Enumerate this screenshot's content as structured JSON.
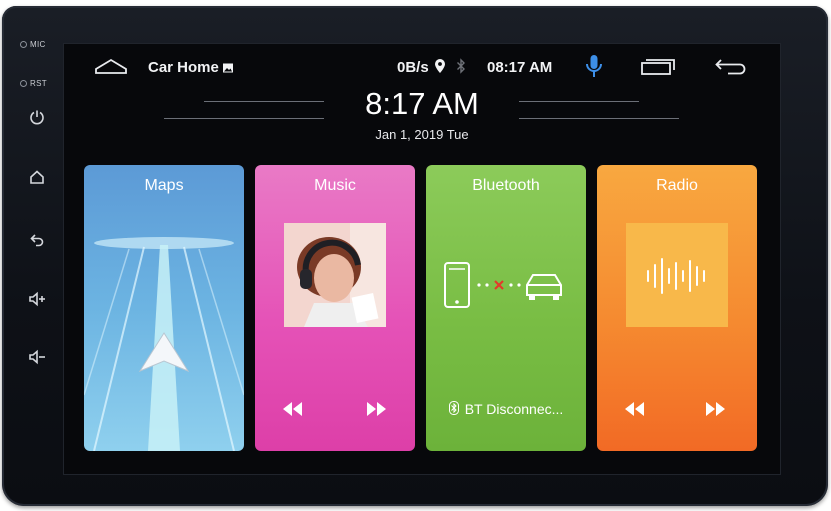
{
  "side_panel": {
    "mic_label": "MIC",
    "rst_label": "RST",
    "buttons": [
      "power-icon",
      "home-icon",
      "back-icon",
      "volume-up-icon",
      "volume-down-icon"
    ]
  },
  "status_bar": {
    "app_title": "Car Home",
    "net_speed": "0B/s",
    "time": "08:17 AM",
    "icons": [
      "home-outline-icon",
      "image-icon",
      "location-pin-icon",
      "bluetooth-icon",
      "microphone-icon",
      "recent-apps-icon",
      "back-arrow-icon"
    ]
  },
  "clock": {
    "time": "8:17 AM",
    "date": "Jan 1, 2019  Tue"
  },
  "cards": {
    "maps": {
      "title": "Maps",
      "color": "#5c9ad6"
    },
    "music": {
      "title": "Music",
      "color": "#e552b7"
    },
    "bluetooth": {
      "title": "Bluetooth",
      "status": "BT Disconnec...",
      "color": "#79bd44"
    },
    "radio": {
      "title": "Radio",
      "color": "#f58a30"
    }
  },
  "colors": {
    "mic_accent": "#3d8fe8",
    "bt_disconnect": "#e23a2a"
  }
}
